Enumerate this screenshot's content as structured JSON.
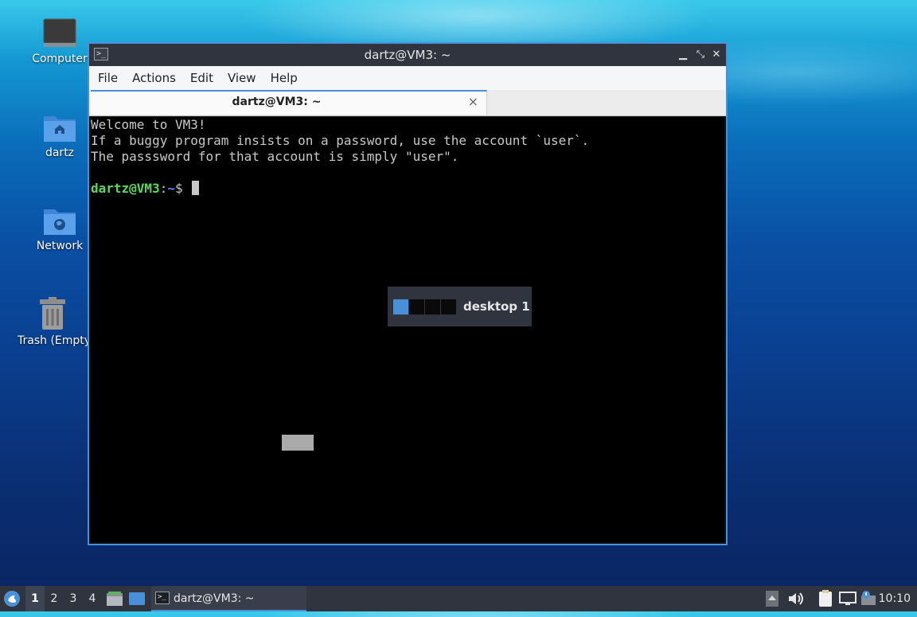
{
  "desktop_icons": [
    {
      "label": "Computer",
      "icon": "computer-icon"
    },
    {
      "label": "dartz",
      "icon": "home-folder-icon"
    },
    {
      "label": "Network",
      "icon": "network-folder-icon"
    },
    {
      "label": "Trash (Empty)",
      "icon": "trash-icon"
    }
  ],
  "window": {
    "title": "dartz@VM3: ~",
    "menu": [
      "File",
      "Actions",
      "Edit",
      "View",
      "Help"
    ],
    "tab_label": "dartz@VM3: ~",
    "tab_close": "×"
  },
  "terminal": {
    "lines": [
      "Welcome to VM3!",
      "If a buggy program insists on a password, use the account `user`.",
      "The passsword for that account is simply \"user\"."
    ],
    "prompt_user": "dartz@VM3",
    "prompt_sep": ":",
    "prompt_path": "~",
    "prompt_symbol": "$ "
  },
  "osd": {
    "label": "desktop 1",
    "workspaces": 4,
    "active": 1
  },
  "taskbar": {
    "workspaces": [
      "1",
      "2",
      "3",
      "4"
    ],
    "active_workspace": "1",
    "task_label": "dartz@VM3: ~",
    "clock": "10:10"
  },
  "colors": {
    "accent": "#4a90d9",
    "panel": "#2f343f",
    "prompt_user": "#5fd75f",
    "prompt_path": "#5f87ff"
  }
}
